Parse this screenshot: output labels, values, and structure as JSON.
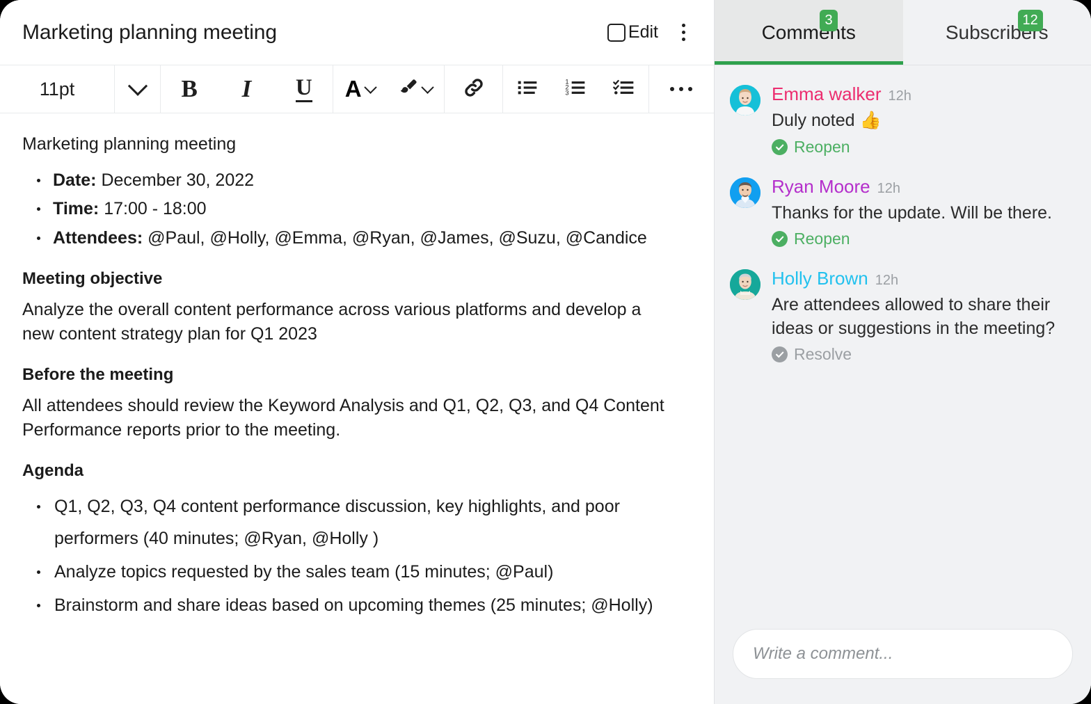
{
  "document": {
    "title": "Marketing planning meeting",
    "edit_label": "Edit",
    "toolbar": {
      "font_size": "11pt",
      "bold": "B",
      "italic": "I",
      "underline": "U",
      "text_color": "A"
    },
    "body": {
      "intro": "Marketing planning meeting",
      "meta": [
        {
          "label": "Date:",
          "value": "December 30, 2022"
        },
        {
          "label": "Time:",
          "value": "17:00 - 18:00"
        },
        {
          "label": "Attendees:",
          "value": "@Paul, @Holly, @Emma, @Ryan, @James, @Suzu, @Candice"
        }
      ],
      "sections": [
        {
          "heading": "Meeting objective",
          "paragraph": "Analyze the overall content performance across various platforms and develop a new content strategy plan for Q1 2023"
        },
        {
          "heading": "Before the meeting",
          "paragraph": "All attendees should review the Keyword Analysis and Q1, Q2, Q3, and Q4 Content Performance reports prior to the meeting."
        }
      ],
      "agenda_heading": "Agenda",
      "agenda_items": [
        "Q1, Q2, Q3, Q4 content performance discussion, key highlights, and poor performers (40 minutes; @Ryan, @Holly )",
        "Analyze topics requested by the sales team (15 minutes; @Paul)",
        "Brainstorm and share ideas based on upcoming themes (25 minutes; @Holly)"
      ]
    }
  },
  "sidebar": {
    "tabs": [
      {
        "label": "Comments",
        "badge": "3",
        "active": true
      },
      {
        "label": "Subscribers",
        "badge": "12",
        "active": false
      }
    ],
    "comments": [
      {
        "author": "Emma walker",
        "author_color": "#ec2d6f",
        "avatar_bg": "#16c0d8",
        "time": "12h",
        "text": "Duly noted 👍",
        "action": "Reopen",
        "action_color": "#4caf62"
      },
      {
        "author": "Ryan Moore",
        "author_color": "#b42ecb",
        "avatar_bg": "#119ff0",
        "time": "12h",
        "text": "Thanks for the update. Will be there.",
        "action": "Reopen",
        "action_color": "#4caf62"
      },
      {
        "author": "Holly Brown",
        "author_color": "#22c1ee",
        "avatar_bg": "#16a89a",
        "time": "12h",
        "text": "Are attendees allowed to share their ideas or suggestions in the meeting?",
        "action": "Resolve",
        "action_color": "#9b9fa3"
      }
    ],
    "composer": {
      "placeholder": "Write a comment..."
    }
  },
  "colors": {
    "accent_green": "#2fa14d",
    "badge_green": "#41ab54",
    "sidebar_bg": "#f1f2f4",
    "active_tab_bg": "#e7e8e8"
  }
}
